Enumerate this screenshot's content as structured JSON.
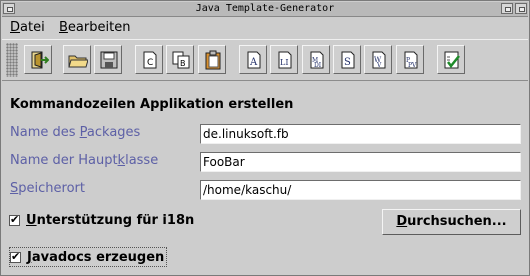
{
  "window": {
    "title": "Java Template-Generator"
  },
  "menu": {
    "items": [
      {
        "label_prefix": "",
        "mnemonic": "D",
        "label_rest": "atei"
      },
      {
        "label_prefix": "",
        "mnemonic": "B",
        "label_rest": "earbeiten"
      }
    ]
  },
  "toolbar": {
    "icons": [
      "exit-icon",
      "open-folder-icon",
      "save-icon",
      "new-class-icon",
      "new-classes-icon",
      "paste-icon",
      "template-a-icon",
      "template-li-icon",
      "template-md-icon",
      "template-s-icon",
      "template-wv-icon",
      "template-pv-icon",
      "validate-icon"
    ]
  },
  "main": {
    "heading": "Kommandozeilen Applikation erstellen",
    "fields": [
      {
        "label_pre": "Name des ",
        "label_mn": "P",
        "label_post": "ackages",
        "value": "de.linuksoft.fb"
      },
      {
        "label_pre": "Name der Haupt",
        "label_mn": "k",
        "label_post": "lasse",
        "value": "FooBar"
      },
      {
        "label_pre": "",
        "label_mn": "S",
        "label_post": "peicherort",
        "value": "/home/kaschu/"
      }
    ],
    "options": [
      {
        "label_pre": "",
        "label_mn": "U",
        "label_post": "nterstützung für i18n",
        "checked": true
      },
      {
        "label_pre": "",
        "label_mn": "J",
        "label_post": "avadocs erzeugen",
        "checked": true
      }
    ],
    "browse_button": {
      "label_pre": "",
      "label_mn": "D",
      "label_post": "urchsuchen..."
    }
  },
  "colors": {
    "label": "#5d60a6",
    "background": "#cdcdcd"
  }
}
